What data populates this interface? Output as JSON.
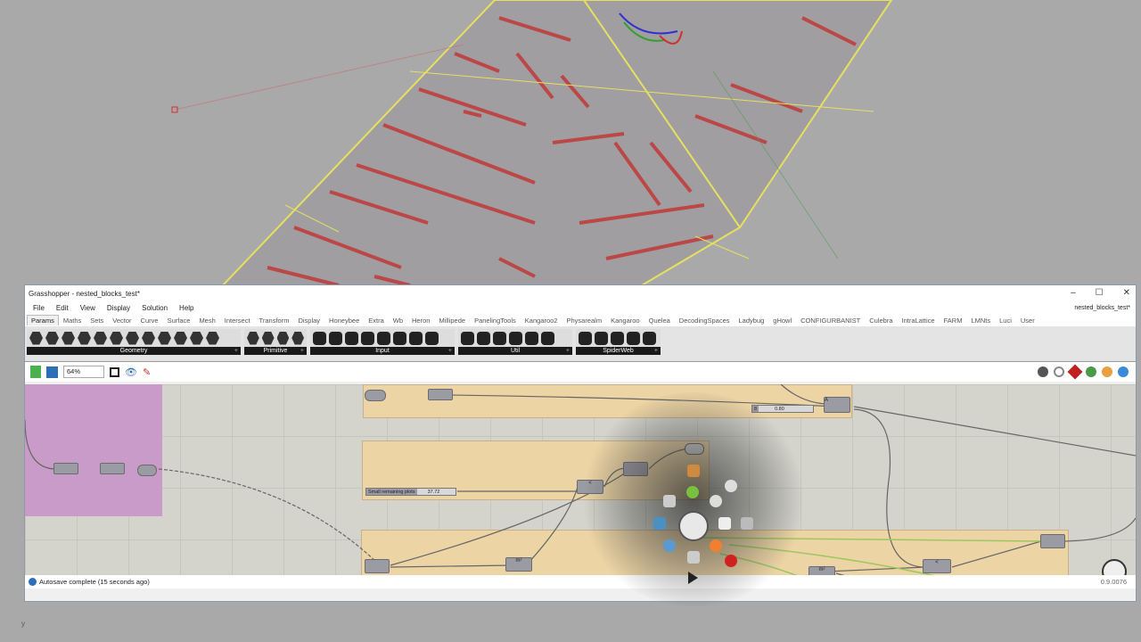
{
  "window": {
    "title": "Grasshopper - nested_blocks_test*",
    "document_name": "nested_blocks_test*",
    "controls": {
      "minimize": "–",
      "maximize": "☐",
      "close": "✕"
    }
  },
  "menu": [
    "File",
    "Edit",
    "View",
    "Display",
    "Solution",
    "Help"
  ],
  "tabs": [
    "Params",
    "Maths",
    "Sets",
    "Vector",
    "Curve",
    "Surface",
    "Mesh",
    "Intersect",
    "Transform",
    "Display",
    "Honeybee",
    "Extra",
    "Wb",
    "Heron",
    "Millipede",
    "PanelingTools",
    "Kangaroo2",
    "Physarealm",
    "Kangaroo",
    "Quelea",
    "DecodingSpaces",
    "Ladybug",
    "gHowl",
    "CONFIGURBANIST",
    "Culebra",
    "IntraLattice",
    "FARM",
    "LMNts",
    "Luci",
    "User"
  ],
  "active_tab": "Params",
  "ribbon_panels": [
    {
      "label": "Geometry",
      "icon_count": 12
    },
    {
      "label": "Primitive",
      "icon_count": 4
    },
    {
      "label": "Input",
      "icon_count": 8
    },
    {
      "label": "Util",
      "icon_count": 6
    },
    {
      "label": "SpiderWeb",
      "icon_count": 5
    }
  ],
  "canvas_toolbar": {
    "zoom": "64%"
  },
  "canvas": {
    "slider1": {
      "label": "8",
      "value": "0.80"
    },
    "slider2": {
      "label": "Small remaining plots",
      "value": "37.72"
    },
    "components": [
      "A",
      "B",
      "<",
      "m²",
      "m²",
      "<"
    ]
  },
  "status": {
    "message": "Autosave complete (15 seconds ago)",
    "version": "0.9.0076"
  },
  "colors": {
    "group_pink": "#c99bc9",
    "group_orange": "#ecd4a4",
    "canvas": "#d4d4cc",
    "plots": "#c03838",
    "road_outline": "#e6e060"
  }
}
